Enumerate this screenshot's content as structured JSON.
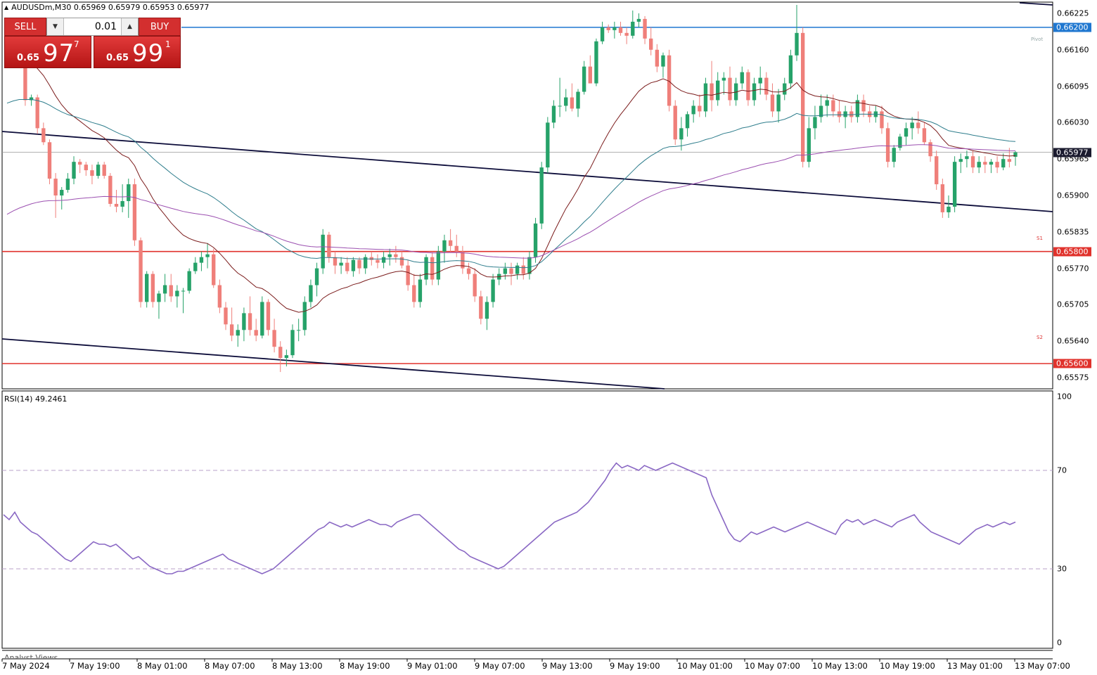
{
  "window": {
    "symbol_info": "AUDUSDm,M30  0.65969 0.65979 0.65953 0.65977"
  },
  "trade_panel": {
    "sell_label": "SELL",
    "buy_label": "BUY",
    "lot_value": "0.01",
    "sell_price": {
      "small": "0.65",
      "big": "97",
      "sup": "7"
    },
    "buy_price": {
      "small": "0.65",
      "big": "99",
      "sup": "1"
    }
  },
  "price_axis": {
    "ticks": [
      "0.66225",
      "0.66160",
      "0.66095",
      "0.66030",
      "0.65965",
      "0.65900",
      "0.65835",
      "0.65770",
      "0.65705",
      "0.65640",
      "0.65575"
    ],
    "tags": [
      {
        "label": "0.66200",
        "color": "#1f77d0"
      },
      {
        "label": "0.65977",
        "color": "#1a1a2e"
      },
      {
        "label": "0.65800",
        "color": "#e0322c"
      },
      {
        "label": "0.65600",
        "color": "#e0322c"
      }
    ]
  },
  "pivot_labels": {
    "pivot": "Pivot",
    "s1": "S1",
    "s2": "S2"
  },
  "rsi": {
    "title": "RSI(14) 49.2461",
    "ticks": [
      "100",
      "70",
      "30",
      "0"
    ]
  },
  "analyst_text": "Analyst Views",
  "time_axis": [
    "7 May 2024",
    "7 May 19:00",
    "8 May 01:00",
    "8 May 07:00",
    "8 May 13:00",
    "8 May 19:00",
    "9 May 01:00",
    "9 May 07:00",
    "9 May 13:00",
    "9 May 19:00",
    "10 May 01:00",
    "10 May 07:00",
    "10 May 13:00",
    "10 May 19:00",
    "13 May 01:00",
    "13 May 07:00"
  ],
  "colors": {
    "bull": "#26a269",
    "bear": "#ef7f7a",
    "ma_fast": "#7b1c1c",
    "ma_mid": "#2e7d8c",
    "ma_slow": "#9b4fb0",
    "trendline": "#0d0d3a",
    "rsi_line": "#8a68c4",
    "resistance": "#1f77d0",
    "support": "#e0322c"
  },
  "chart_data": {
    "type": "candlestick",
    "symbol": "AUDUSDm",
    "timeframe": "M30",
    "ylim": [
      0.65555,
      0.66245
    ],
    "ohlc": [
      [
        0.66186,
        0.6619,
        0.6617,
        0.6618
      ],
      [
        0.6618,
        0.66185,
        0.6616,
        0.66165
      ],
      [
        0.66165,
        0.6617,
        0.6613,
        0.66135
      ],
      [
        0.66135,
        0.6614,
        0.6606,
        0.6607
      ],
      [
        0.6607,
        0.6608,
        0.6606,
        0.66075
      ],
      [
        0.66075,
        0.6608,
        0.6601,
        0.6602
      ],
      [
        0.6602,
        0.6603,
        0.6599,
        0.65995
      ],
      [
        0.65995,
        0.66,
        0.6592,
        0.6593
      ],
      [
        0.6593,
        0.6594,
        0.6586,
        0.659
      ],
      [
        0.659,
        0.65915,
        0.65875,
        0.6591
      ],
      [
        0.6591,
        0.6594,
        0.65905,
        0.6593
      ],
      [
        0.6593,
        0.6597,
        0.6592,
        0.6596
      ],
      [
        0.6596,
        0.65965,
        0.6594,
        0.65955
      ],
      [
        0.65955,
        0.6596,
        0.65935,
        0.65945
      ],
      [
        0.65945,
        0.65955,
        0.6592,
        0.65935
      ],
      [
        0.65935,
        0.6596,
        0.6593,
        0.65955
      ],
      [
        0.65955,
        0.6596,
        0.6593,
        0.65935
      ],
      [
        0.65935,
        0.6594,
        0.6588,
        0.65885
      ],
      [
        0.65885,
        0.6591,
        0.6587,
        0.6588
      ],
      [
        0.6588,
        0.6592,
        0.6587,
        0.6589
      ],
      [
        0.6589,
        0.6593,
        0.6586,
        0.6592
      ],
      [
        0.6592,
        0.6593,
        0.6581,
        0.6582
      ],
      [
        0.6582,
        0.65825,
        0.657,
        0.6571
      ],
      [
        0.6571,
        0.65765,
        0.657,
        0.6576
      ],
      [
        0.6576,
        0.65765,
        0.657,
        0.6571
      ],
      [
        0.6571,
        0.6573,
        0.6568,
        0.65725
      ],
      [
        0.65725,
        0.6576,
        0.6571,
        0.6574
      ],
      [
        0.6574,
        0.6576,
        0.6571,
        0.6572
      ],
      [
        0.6572,
        0.6574,
        0.657,
        0.6573
      ],
      [
        0.6573,
        0.65735,
        0.6569,
        0.6573
      ],
      [
        0.6573,
        0.6577,
        0.65725,
        0.65765
      ],
      [
        0.65765,
        0.6579,
        0.6576,
        0.6578
      ],
      [
        0.6578,
        0.658,
        0.65765,
        0.6579
      ],
      [
        0.6579,
        0.65815,
        0.6577,
        0.65795
      ],
      [
        0.65795,
        0.65805,
        0.65735,
        0.6574
      ],
      [
        0.6574,
        0.6575,
        0.6569,
        0.657
      ],
      [
        0.657,
        0.6571,
        0.6566,
        0.6567
      ],
      [
        0.6567,
        0.657,
        0.6564,
        0.6565
      ],
      [
        0.6565,
        0.6567,
        0.6563,
        0.6566
      ],
      [
        0.6566,
        0.657,
        0.6564,
        0.6569
      ],
      [
        0.6569,
        0.6572,
        0.6565,
        0.6566
      ],
      [
        0.6566,
        0.6568,
        0.6564,
        0.6565
      ],
      [
        0.6565,
        0.6572,
        0.65645,
        0.6571
      ],
      [
        0.6571,
        0.65715,
        0.6565,
        0.6566
      ],
      [
        0.6566,
        0.6568,
        0.6562,
        0.6563
      ],
      [
        0.6563,
        0.6564,
        0.65585,
        0.6561
      ],
      [
        0.6561,
        0.65625,
        0.65595,
        0.65615
      ],
      [
        0.65615,
        0.6567,
        0.6561,
        0.6566
      ],
      [
        0.6566,
        0.6568,
        0.6564,
        0.6566
      ],
      [
        0.6566,
        0.6572,
        0.6565,
        0.6571
      ],
      [
        0.6571,
        0.6575,
        0.657,
        0.6574
      ],
      [
        0.6574,
        0.6578,
        0.6572,
        0.6577
      ],
      [
        0.6577,
        0.6584,
        0.6576,
        0.6583
      ],
      [
        0.6583,
        0.65835,
        0.6578,
        0.6579
      ],
      [
        0.6579,
        0.658,
        0.6576,
        0.65775
      ],
      [
        0.65775,
        0.6579,
        0.6576,
        0.6578
      ],
      [
        0.6578,
        0.6579,
        0.6576,
        0.65765
      ],
      [
        0.65765,
        0.6579,
        0.65755,
        0.65785
      ],
      [
        0.65785,
        0.6579,
        0.6576,
        0.6577
      ],
      [
        0.6577,
        0.65795,
        0.6576,
        0.6579
      ],
      [
        0.6579,
        0.658,
        0.65775,
        0.65785
      ],
      [
        0.65785,
        0.65795,
        0.6577,
        0.6578
      ],
      [
        0.6578,
        0.658,
        0.6577,
        0.6579
      ],
      [
        0.6579,
        0.65805,
        0.65775,
        0.65795
      ],
      [
        0.65795,
        0.6581,
        0.6578,
        0.6579
      ],
      [
        0.6579,
        0.658,
        0.6577,
        0.65775
      ],
      [
        0.65775,
        0.65785,
        0.6573,
        0.6574
      ],
      [
        0.6574,
        0.6576,
        0.657,
        0.6571
      ],
      [
        0.6571,
        0.6576,
        0.657,
        0.6575
      ],
      [
        0.6575,
        0.65795,
        0.6574,
        0.6579
      ],
      [
        0.6579,
        0.658,
        0.6574,
        0.6575
      ],
      [
        0.6575,
        0.6581,
        0.6574,
        0.658
      ],
      [
        0.658,
        0.6583,
        0.6578,
        0.6582
      ],
      [
        0.6582,
        0.6584,
        0.658,
        0.6581
      ],
      [
        0.6581,
        0.6583,
        0.6579,
        0.658
      ],
      [
        0.658,
        0.6581,
        0.6576,
        0.6577
      ],
      [
        0.6577,
        0.6578,
        0.6575,
        0.6576
      ],
      [
        0.6576,
        0.6577,
        0.6571,
        0.6572
      ],
      [
        0.6572,
        0.6573,
        0.6567,
        0.6568
      ],
      [
        0.6568,
        0.6572,
        0.6566,
        0.6571
      ],
      [
        0.6571,
        0.6576,
        0.657,
        0.6575
      ],
      [
        0.6575,
        0.6577,
        0.6574,
        0.6576
      ],
      [
        0.6576,
        0.6578,
        0.6575,
        0.6577
      ],
      [
        0.6577,
        0.6578,
        0.6574,
        0.6576
      ],
      [
        0.6576,
        0.6578,
        0.6575,
        0.65775
      ],
      [
        0.65775,
        0.6579,
        0.6575,
        0.6576
      ],
      [
        0.6576,
        0.658,
        0.6575,
        0.6579
      ],
      [
        0.6579,
        0.6586,
        0.6578,
        0.6585
      ],
      [
        0.6585,
        0.6596,
        0.6584,
        0.6595
      ],
      [
        0.6595,
        0.6604,
        0.6594,
        0.6603
      ],
      [
        0.6603,
        0.6607,
        0.6602,
        0.6606
      ],
      [
        0.6606,
        0.6611,
        0.6604,
        0.6606
      ],
      [
        0.6606,
        0.6609,
        0.6605,
        0.66075
      ],
      [
        0.66075,
        0.661,
        0.6605,
        0.66055
      ],
      [
        0.66055,
        0.6609,
        0.6604,
        0.66085
      ],
      [
        0.66085,
        0.6614,
        0.6608,
        0.6613
      ],
      [
        0.6613,
        0.6615,
        0.661,
        0.661
      ],
      [
        0.661,
        0.6618,
        0.66095,
        0.66175
      ],
      [
        0.66175,
        0.6621,
        0.6617,
        0.662
      ],
      [
        0.662,
        0.66205,
        0.6619,
        0.66195
      ],
      [
        0.66195,
        0.6621,
        0.6618,
        0.662
      ],
      [
        0.662,
        0.6621,
        0.66185,
        0.6619
      ],
      [
        0.6619,
        0.662,
        0.6617,
        0.66185
      ],
      [
        0.66185,
        0.6623,
        0.6618,
        0.6621
      ],
      [
        0.6621,
        0.66225,
        0.662,
        0.66215
      ],
      [
        0.66215,
        0.6622,
        0.6617,
        0.6618
      ],
      [
        0.6618,
        0.662,
        0.6615,
        0.6616
      ],
      [
        0.6616,
        0.6617,
        0.6612,
        0.6613
      ],
      [
        0.6613,
        0.66155,
        0.6611,
        0.6615
      ],
      [
        0.6615,
        0.6616,
        0.6605,
        0.6606
      ],
      [
        0.6606,
        0.6607,
        0.6599,
        0.66
      ],
      [
        0.66,
        0.6604,
        0.6598,
        0.6602
      ],
      [
        0.6602,
        0.6605,
        0.66005,
        0.66045
      ],
      [
        0.66045,
        0.6607,
        0.6603,
        0.6606
      ],
      [
        0.6606,
        0.6608,
        0.6604,
        0.6605
      ],
      [
        0.6605,
        0.6611,
        0.6604,
        0.661
      ],
      [
        0.661,
        0.6614,
        0.6605,
        0.6607
      ],
      [
        0.6607,
        0.6612,
        0.6606,
        0.66105
      ],
      [
        0.66105,
        0.6612,
        0.6608,
        0.6611
      ],
      [
        0.6611,
        0.6613,
        0.6606,
        0.6607
      ],
      [
        0.6607,
        0.6611,
        0.6606,
        0.661
      ],
      [
        0.661,
        0.6613,
        0.6609,
        0.6612
      ],
      [
        0.6612,
        0.66125,
        0.6606,
        0.6607
      ],
      [
        0.6607,
        0.6611,
        0.6606,
        0.661
      ],
      [
        0.661,
        0.6613,
        0.6608,
        0.6611
      ],
      [
        0.6611,
        0.6612,
        0.6607,
        0.6608
      ],
      [
        0.6608,
        0.661,
        0.6604,
        0.6605
      ],
      [
        0.6605,
        0.6609,
        0.6603,
        0.6608
      ],
      [
        0.6608,
        0.6611,
        0.6607,
        0.661
      ],
      [
        0.661,
        0.6616,
        0.6609,
        0.6615
      ],
      [
        0.6615,
        0.6624,
        0.6614,
        0.6619
      ],
      [
        0.6619,
        0.662,
        0.6595,
        0.6596
      ],
      [
        0.6596,
        0.6604,
        0.6595,
        0.6602
      ],
      [
        0.6602,
        0.6606,
        0.66,
        0.6604
      ],
      [
        0.6604,
        0.6608,
        0.6603,
        0.6606
      ],
      [
        0.6606,
        0.6608,
        0.6604,
        0.6607
      ],
      [
        0.6607,
        0.6608,
        0.6604,
        0.6605
      ],
      [
        0.6605,
        0.6607,
        0.6603,
        0.6604
      ],
      [
        0.6604,
        0.6606,
        0.6602,
        0.6605
      ],
      [
        0.6605,
        0.6606,
        0.6603,
        0.6604
      ],
      [
        0.6604,
        0.6608,
        0.6603,
        0.6607
      ],
      [
        0.6607,
        0.6608,
        0.6604,
        0.6605
      ],
      [
        0.6605,
        0.6606,
        0.6603,
        0.6604
      ],
      [
        0.6604,
        0.6606,
        0.6603,
        0.6605
      ],
      [
        0.6605,
        0.6606,
        0.6601,
        0.6602
      ],
      [
        0.6602,
        0.6603,
        0.6595,
        0.6596
      ],
      [
        0.6596,
        0.6599,
        0.6595,
        0.65985
      ],
      [
        0.65985,
        0.6601,
        0.6598,
        0.66005
      ],
      [
        0.66005,
        0.6603,
        0.6599,
        0.6602
      ],
      [
        0.6602,
        0.6604,
        0.66,
        0.6603
      ],
      [
        0.6603,
        0.6605,
        0.6601,
        0.6602
      ],
      [
        0.6602,
        0.6603,
        0.6599,
        0.65995
      ],
      [
        0.65995,
        0.66,
        0.6596,
        0.6597
      ],
      [
        0.6597,
        0.6598,
        0.6591,
        0.6592
      ],
      [
        0.6592,
        0.6593,
        0.6586,
        0.6587
      ],
      [
        0.6587,
        0.659,
        0.6586,
        0.6588
      ],
      [
        0.6588,
        0.6597,
        0.6587,
        0.6596
      ],
      [
        0.6596,
        0.65975,
        0.6594,
        0.65965
      ],
      [
        0.65965,
        0.6598,
        0.6595,
        0.6597
      ],
      [
        0.6597,
        0.6598,
        0.6594,
        0.6595
      ],
      [
        0.6595,
        0.6597,
        0.6594,
        0.6596
      ],
      [
        0.6596,
        0.6597,
        0.6594,
        0.65955
      ],
      [
        0.65955,
        0.65965,
        0.6594,
        0.6596
      ],
      [
        0.6596,
        0.6597,
        0.6594,
        0.6595
      ],
      [
        0.6595,
        0.65975,
        0.65945,
        0.65965
      ],
      [
        0.65965,
        0.65985,
        0.6595,
        0.6596
      ],
      [
        0.65969,
        0.65979,
        0.65953,
        0.65977
      ]
    ],
    "horizontal_levels": [
      0.662,
      0.65977,
      0.658,
      0.656
    ],
    "rsi_values": [
      52,
      50,
      53,
      49,
      47,
      45,
      44,
      42,
      40,
      38,
      36,
      34,
      33,
      35,
      37,
      39,
      41,
      40,
      40,
      39,
      40,
      38,
      36,
      34,
      35,
      33,
      31,
      30,
      29,
      28,
      28,
      29,
      29,
      30,
      31,
      32,
      33,
      34,
      35,
      36,
      34,
      33,
      32,
      31,
      30,
      29,
      28,
      29,
      30,
      32,
      34,
      36,
      38,
      40,
      42,
      44,
      46,
      47,
      49,
      48,
      47,
      48,
      47,
      48,
      49,
      50,
      49,
      48,
      48,
      47,
      49,
      50,
      51,
      52,
      52,
      50,
      48,
      46,
      44,
      42,
      40,
      38,
      37,
      35,
      34,
      33,
      32,
      31,
      30,
      31,
      33,
      35,
      37,
      39,
      41,
      43,
      45,
      47,
      49,
      50,
      51,
      52,
      53,
      55,
      57,
      60,
      63,
      66,
      70,
      73,
      71,
      72,
      71,
      70,
      72,
      71,
      70,
      71,
      72,
      73,
      72,
      71,
      70,
      69,
      68,
      67,
      60,
      55,
      50,
      45,
      42,
      41,
      43,
      45,
      44,
      45,
      46,
      47,
      46,
      45,
      46,
      47,
      48,
      49,
      48,
      47,
      46,
      45,
      44,
      48,
      50,
      49,
      50,
      48,
      49,
      50,
      49,
      48,
      47,
      49,
      50,
      51,
      52,
      49,
      47,
      45,
      44,
      43,
      42,
      41,
      40,
      42,
      44,
      46,
      47,
      48,
      47,
      48,
      49,
      48,
      49
    ]
  }
}
